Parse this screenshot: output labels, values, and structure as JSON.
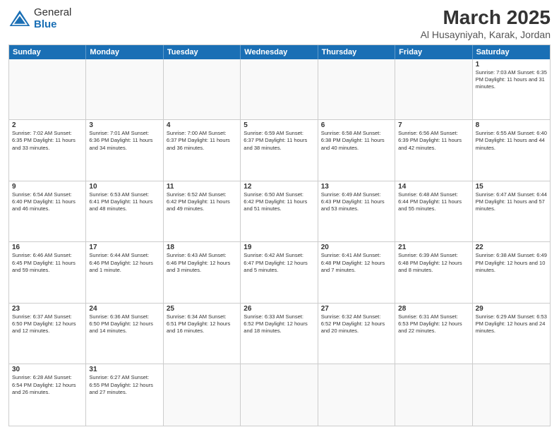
{
  "header": {
    "logo_general": "General",
    "logo_blue": "Blue",
    "main_title": "March 2025",
    "subtitle": "Al Husayniyah, Karak, Jordan"
  },
  "days": [
    "Sunday",
    "Monday",
    "Tuesday",
    "Wednesday",
    "Thursday",
    "Friday",
    "Saturday"
  ],
  "weeks": [
    [
      {
        "day": "",
        "info": ""
      },
      {
        "day": "",
        "info": ""
      },
      {
        "day": "",
        "info": ""
      },
      {
        "day": "",
        "info": ""
      },
      {
        "day": "",
        "info": ""
      },
      {
        "day": "",
        "info": ""
      },
      {
        "day": "1",
        "info": "Sunrise: 7:03 AM\nSunset: 6:35 PM\nDaylight: 11 hours\nand 31 minutes."
      }
    ],
    [
      {
        "day": "2",
        "info": "Sunrise: 7:02 AM\nSunset: 6:35 PM\nDaylight: 11 hours\nand 33 minutes."
      },
      {
        "day": "3",
        "info": "Sunrise: 7:01 AM\nSunset: 6:36 PM\nDaylight: 11 hours\nand 34 minutes."
      },
      {
        "day": "4",
        "info": "Sunrise: 7:00 AM\nSunset: 6:37 PM\nDaylight: 11 hours\nand 36 minutes."
      },
      {
        "day": "5",
        "info": "Sunrise: 6:59 AM\nSunset: 6:37 PM\nDaylight: 11 hours\nand 38 minutes."
      },
      {
        "day": "6",
        "info": "Sunrise: 6:58 AM\nSunset: 6:38 PM\nDaylight: 11 hours\nand 40 minutes."
      },
      {
        "day": "7",
        "info": "Sunrise: 6:56 AM\nSunset: 6:39 PM\nDaylight: 11 hours\nand 42 minutes."
      },
      {
        "day": "8",
        "info": "Sunrise: 6:55 AM\nSunset: 6:40 PM\nDaylight: 11 hours\nand 44 minutes."
      }
    ],
    [
      {
        "day": "9",
        "info": "Sunrise: 6:54 AM\nSunset: 6:40 PM\nDaylight: 11 hours\nand 46 minutes."
      },
      {
        "day": "10",
        "info": "Sunrise: 6:53 AM\nSunset: 6:41 PM\nDaylight: 11 hours\nand 48 minutes."
      },
      {
        "day": "11",
        "info": "Sunrise: 6:52 AM\nSunset: 6:42 PM\nDaylight: 11 hours\nand 49 minutes."
      },
      {
        "day": "12",
        "info": "Sunrise: 6:50 AM\nSunset: 6:42 PM\nDaylight: 11 hours\nand 51 minutes."
      },
      {
        "day": "13",
        "info": "Sunrise: 6:49 AM\nSunset: 6:43 PM\nDaylight: 11 hours\nand 53 minutes."
      },
      {
        "day": "14",
        "info": "Sunrise: 6:48 AM\nSunset: 6:44 PM\nDaylight: 11 hours\nand 55 minutes."
      },
      {
        "day": "15",
        "info": "Sunrise: 6:47 AM\nSunset: 6:44 PM\nDaylight: 11 hours\nand 57 minutes."
      }
    ],
    [
      {
        "day": "16",
        "info": "Sunrise: 6:46 AM\nSunset: 6:45 PM\nDaylight: 11 hours\nand 59 minutes."
      },
      {
        "day": "17",
        "info": "Sunrise: 6:44 AM\nSunset: 6:46 PM\nDaylight: 12 hours\nand 1 minute."
      },
      {
        "day": "18",
        "info": "Sunrise: 6:43 AM\nSunset: 6:46 PM\nDaylight: 12 hours\nand 3 minutes."
      },
      {
        "day": "19",
        "info": "Sunrise: 6:42 AM\nSunset: 6:47 PM\nDaylight: 12 hours\nand 5 minutes."
      },
      {
        "day": "20",
        "info": "Sunrise: 6:41 AM\nSunset: 6:48 PM\nDaylight: 12 hours\nand 7 minutes."
      },
      {
        "day": "21",
        "info": "Sunrise: 6:39 AM\nSunset: 6:48 PM\nDaylight: 12 hours\nand 8 minutes."
      },
      {
        "day": "22",
        "info": "Sunrise: 6:38 AM\nSunset: 6:49 PM\nDaylight: 12 hours\nand 10 minutes."
      }
    ],
    [
      {
        "day": "23",
        "info": "Sunrise: 6:37 AM\nSunset: 6:50 PM\nDaylight: 12 hours\nand 12 minutes."
      },
      {
        "day": "24",
        "info": "Sunrise: 6:36 AM\nSunset: 6:50 PM\nDaylight: 12 hours\nand 14 minutes."
      },
      {
        "day": "25",
        "info": "Sunrise: 6:34 AM\nSunset: 6:51 PM\nDaylight: 12 hours\nand 16 minutes."
      },
      {
        "day": "26",
        "info": "Sunrise: 6:33 AM\nSunset: 6:52 PM\nDaylight: 12 hours\nand 18 minutes."
      },
      {
        "day": "27",
        "info": "Sunrise: 6:32 AM\nSunset: 6:52 PM\nDaylight: 12 hours\nand 20 minutes."
      },
      {
        "day": "28",
        "info": "Sunrise: 6:31 AM\nSunset: 6:53 PM\nDaylight: 12 hours\nand 22 minutes."
      },
      {
        "day": "29",
        "info": "Sunrise: 6:29 AM\nSunset: 6:53 PM\nDaylight: 12 hours\nand 24 minutes."
      }
    ],
    [
      {
        "day": "30",
        "info": "Sunrise: 6:28 AM\nSunset: 6:54 PM\nDaylight: 12 hours\nand 26 minutes."
      },
      {
        "day": "31",
        "info": "Sunrise: 6:27 AM\nSunset: 6:55 PM\nDaylight: 12 hours\nand 27 minutes."
      },
      {
        "day": "",
        "info": ""
      },
      {
        "day": "",
        "info": ""
      },
      {
        "day": "",
        "info": ""
      },
      {
        "day": "",
        "info": ""
      },
      {
        "day": "",
        "info": ""
      }
    ]
  ]
}
